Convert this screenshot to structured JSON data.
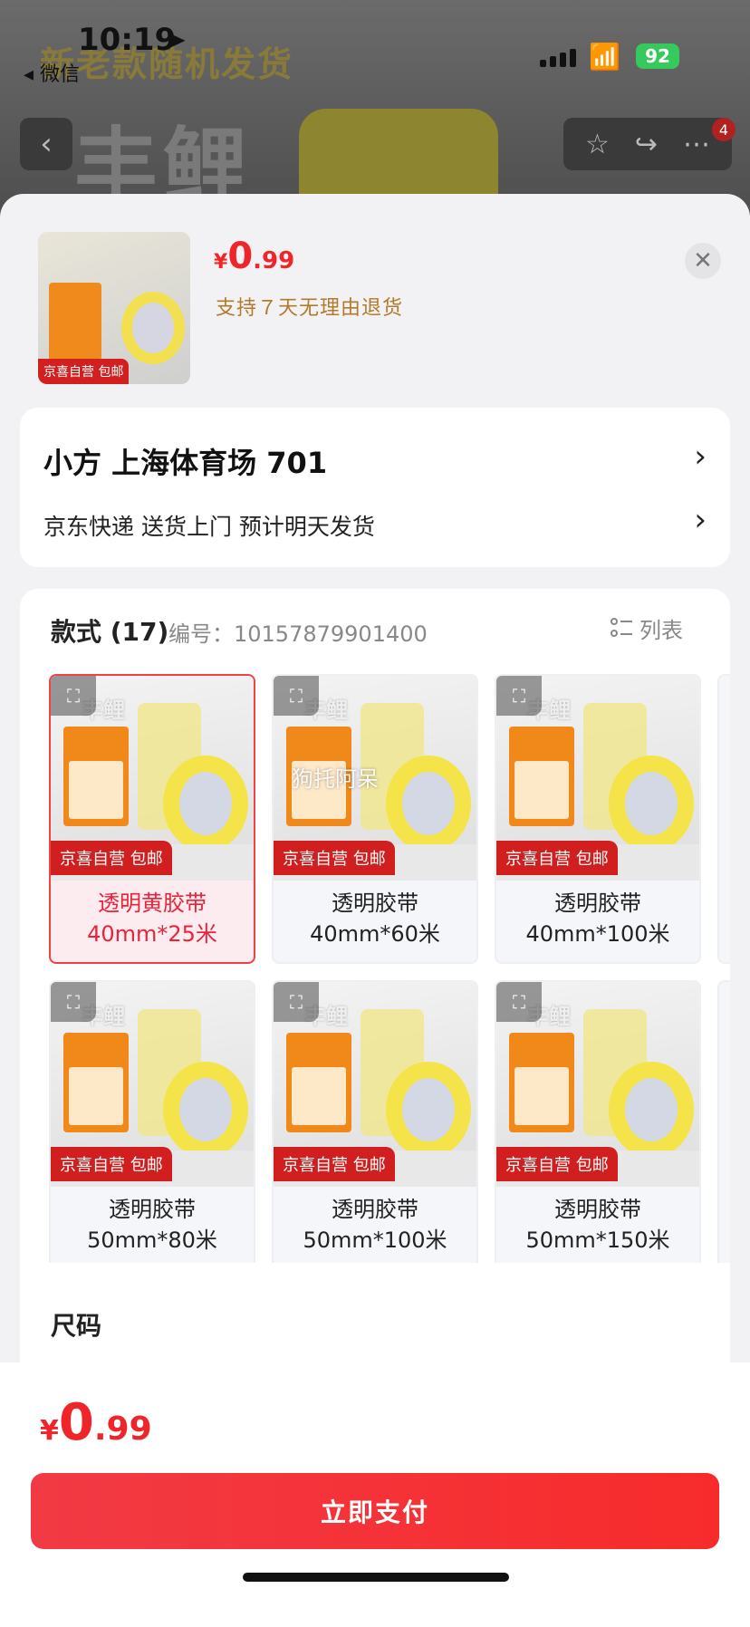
{
  "status_bar": {
    "time": "10:19",
    "back_app": "◂ 微信",
    "battery": "92"
  },
  "background": {
    "banner_text": "新老款随机发货",
    "brand": "丰鲤",
    "cart_badge": "4"
  },
  "product": {
    "currency": "¥",
    "price_int": "0",
    "price_dec": ".99",
    "return_policy": "支持７天无理由退货",
    "thumb_tag": "京喜自营 包邮"
  },
  "address": {
    "name_addr": "小方  上海体育场 701",
    "shipping": "京东快递 送货上门 预计明天发货"
  },
  "style_section": {
    "title": "款式 (17)",
    "code": "编号：10157879901400",
    "list_label": "列表",
    "tile_tag": "京喜自营 包邮",
    "expand_icon": "expand-icon",
    "watermark": "狗托阿呆",
    "items": [
      {
        "line1": "透明黄胶带",
        "line2": "40mm*25米",
        "selected": true
      },
      {
        "line1": "透明胶带",
        "line2": "40mm*60米",
        "selected": false
      },
      {
        "line1": "透明胶带",
        "line2": "40mm*100米",
        "selected": false
      },
      {
        "line1": "透明胶带",
        "line2": "50mm*80米",
        "selected": false
      },
      {
        "line1": "透明胶带",
        "line2": "50mm*100米",
        "selected": false
      },
      {
        "line1": "透明胶带",
        "line2": "50mm*150米",
        "selected": false
      }
    ],
    "size_label": "尺码"
  },
  "bottom": {
    "currency": "¥",
    "price_int": "0",
    "price_dec": ".99",
    "pay_label": "立即支付"
  },
  "colors": {
    "accent": "#f0252a",
    "return_text": "#b27a2a",
    "selected_border": "#f0404a"
  }
}
